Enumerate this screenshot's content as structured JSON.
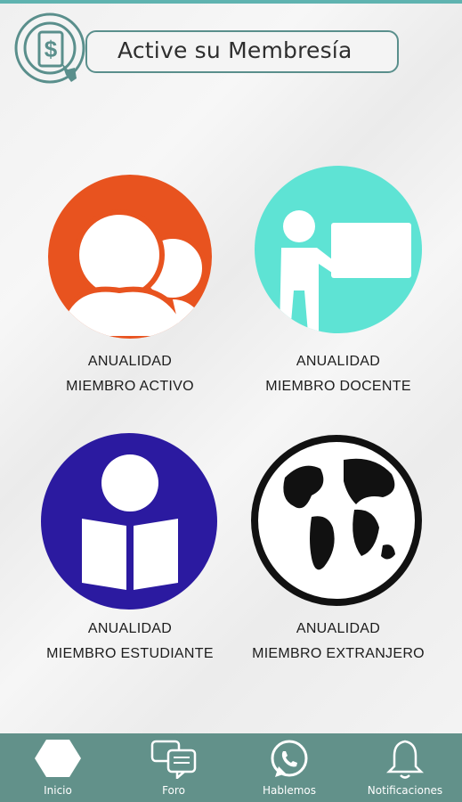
{
  "header": {
    "title": "Active su Membresía",
    "logo_icon": "dollar-card-icon"
  },
  "tiles": [
    {
      "line1": "ANUALIDAD",
      "line2": "MIEMBRO ACTIVO",
      "icon": "members-group-icon",
      "color": "#e8531f"
    },
    {
      "line1": "ANUALIDAD",
      "line2": "MIEMBRO DOCENTE",
      "icon": "teacher-board-icon",
      "color": "#5ee3d4"
    },
    {
      "line1": "ANUALIDAD",
      "line2": "MIEMBRO ESTUDIANTE",
      "icon": "student-reading-icon",
      "color": "#2b1aa0"
    },
    {
      "line1": "ANUALIDAD",
      "line2": "MIEMBRO EXTRANJERO",
      "icon": "globe-icon",
      "color": "#111111"
    }
  ],
  "nav": [
    {
      "label": "Inicio",
      "icon": "home-hexagon-icon"
    },
    {
      "label": "Foro",
      "icon": "forum-chat-icon"
    },
    {
      "label": "Hablemos",
      "icon": "whatsapp-icon"
    },
    {
      "label": "Notificaciones",
      "icon": "bell-icon"
    }
  ],
  "colors": {
    "accent": "#62918a",
    "topline": "#5fb3b0"
  }
}
